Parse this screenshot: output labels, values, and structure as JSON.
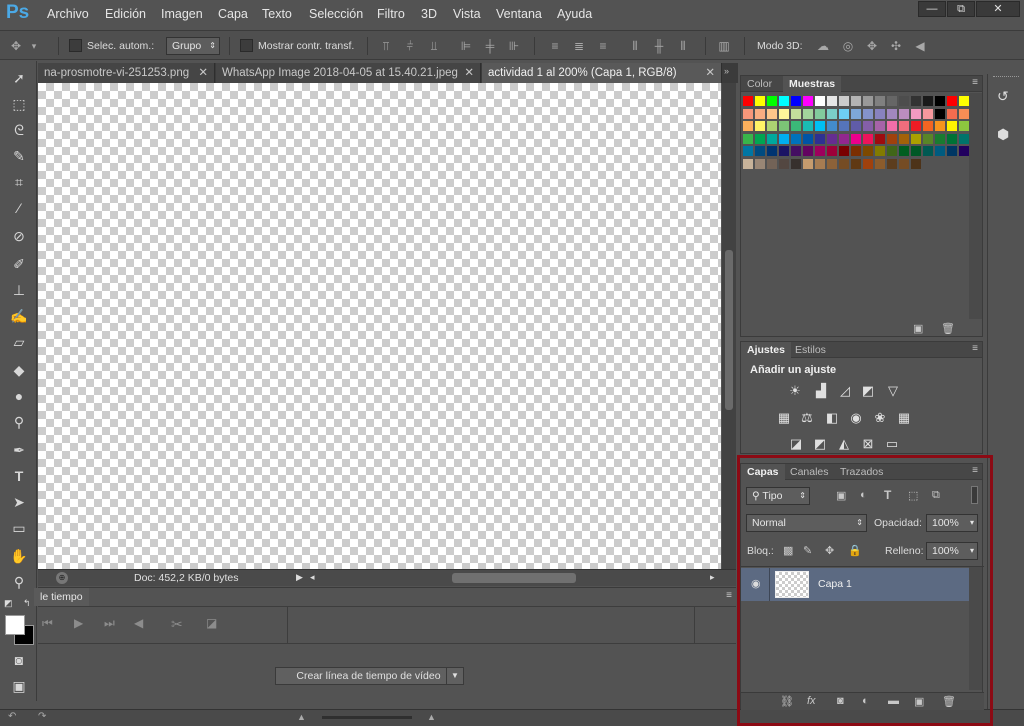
{
  "app": {
    "logo": "Ps",
    "window_controls": {
      "minimize": "—",
      "restore": "⧉",
      "close": "✕"
    }
  },
  "menu": [
    "Archivo",
    "Edición",
    "Imagen",
    "Capa",
    "Texto",
    "Selección",
    "Filtro",
    "3D",
    "Vista",
    "Ventana",
    "Ayuda"
  ],
  "options_bar": {
    "auto_select_label": "Selec. autom.:",
    "auto_select_value": "Grupo",
    "show_transform_label": "Mostrar contr. transf.",
    "mode3d_label": "Modo 3D:"
  },
  "doc_tabs": [
    {
      "label": "na-prosmotre-vi-251253.png",
      "active": false
    },
    {
      "label": "WhatsApp Image 2018-04-05 at 15.40.21.jpeg",
      "active": false
    },
    {
      "label": "actividad 1 al 200% (Capa 1, RGB/8)",
      "active": true
    }
  ],
  "status": {
    "doc_info": "Doc: 452,2 KB/0 bytes"
  },
  "timeline": {
    "tab_label": "le tiempo",
    "create_button": "Crear línea de tiempo de vídeo"
  },
  "swatch_panel": {
    "tabs": [
      "Color",
      "Muestras"
    ]
  },
  "adjust_panel": {
    "tabs": [
      "Ajustes",
      "Estilos"
    ],
    "title": "Añadir un ajuste"
  },
  "layers_panel": {
    "tabs": [
      "Capas",
      "Canales",
      "Trazados"
    ],
    "filter_kind": "Tipo",
    "blend_mode": "Normal",
    "opacity_label": "Opacidad:",
    "opacity_value": "100%",
    "lock_label": "Bloq.:",
    "fill_label": "Relleno:",
    "fill_value": "100%",
    "layers": [
      {
        "name": "Capa 1"
      }
    ]
  },
  "colors": {
    "swatch_rows": [
      [
        "#ff0000",
        "#ffff00",
        "#00ff00",
        "#00ffff",
        "#0000ff",
        "#ff00ff",
        "#ffffff",
        "#e6e6e6",
        "#cccccc",
        "#b3b3b3",
        "#999999",
        "#808080",
        "#666666",
        "#4d4d4d",
        "#333333",
        "#1a1a1a",
        "#000000",
        "#ff0000",
        "#ffff00"
      ],
      [
        "#f7977a",
        "#f9ad81",
        "#fdc68a",
        "#fff79a",
        "#c4df9b",
        "#a2d39c",
        "#82ca9d",
        "#7bcdc8",
        "#6ecff6",
        "#7ea7d8",
        "#8493ca",
        "#8882be",
        "#a187be",
        "#bc8dbf",
        "#f49ac2",
        "#f6989d",
        "#000000",
        "#f26c4f",
        "#f68e55"
      ],
      [
        "#fbaf5c",
        "#fff467",
        "#acd372",
        "#7cc576",
        "#3bb878",
        "#1abbb4",
        "#00bff3",
        "#438ccb",
        "#5574b9",
        "#605ca8",
        "#855fa8",
        "#a763a8",
        "#f06ea9",
        "#f26d7d",
        "#ed1c24",
        "#f26522",
        "#f7941d",
        "#fff200",
        "#8dc63f"
      ],
      [
        "#39b54a",
        "#00a651",
        "#00a99d",
        "#00aeef",
        "#0072bc",
        "#0054a6",
        "#2e3192",
        "#662d91",
        "#92278f",
        "#ec008c",
        "#ed145b",
        "#9e0b0f",
        "#a0410d",
        "#a36209",
        "#aba000",
        "#598527",
        "#197b30",
        "#007236",
        "#00746b"
      ],
      [
        "#0076a3",
        "#004b80",
        "#003471",
        "#1b1464",
        "#440e62",
        "#630460",
        "#9e005d",
        "#9e0039",
        "#790000",
        "#7b2e00",
        "#7d4900",
        "#827b00",
        "#406618",
        "#005e20",
        "#005826",
        "#005952",
        "#005b7f",
        "#003663",
        "#21005e"
      ],
      [
        "#c7b299",
        "#998675",
        "#736357",
        "#534741",
        "#37302d",
        "#c69c6e",
        "#a67c52",
        "#8c6239",
        "#754c24",
        "#603913",
        "#a0410d",
        "#8c5c2c",
        "#5c3d1e",
        "#754c24",
        "#4d3319"
      ]
    ]
  }
}
